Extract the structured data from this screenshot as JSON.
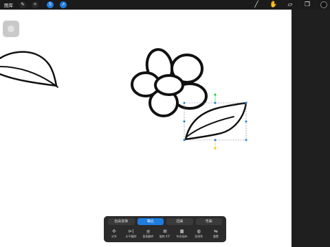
{
  "topbar": {
    "gallery_label": "图库",
    "left_tools": [
      {
        "name": "wrench-icon",
        "glyph": "✎",
        "active": false
      },
      {
        "name": "magic-wand-icon",
        "glyph": "✧",
        "active": false
      },
      {
        "name": "selection-icon",
        "glyph": "S",
        "active": true
      },
      {
        "name": "transform-arrow-icon",
        "glyph": "➚",
        "active": true
      }
    ],
    "right_tools": [
      {
        "name": "brush-icon",
        "glyph": "╱"
      },
      {
        "name": "smudge-icon",
        "glyph": "✋"
      },
      {
        "name": "eraser-icon",
        "glyph": "▱"
      },
      {
        "name": "layers-icon",
        "glyph": "❐"
      }
    ],
    "color_swatch": "#111111"
  },
  "transform": {
    "modes": [
      {
        "label": "自由变换",
        "active": false
      },
      {
        "label": "等比",
        "active": true
      },
      {
        "label": "扭曲",
        "active": false
      },
      {
        "label": "弯曲",
        "active": false
      }
    ],
    "actions": [
      {
        "icon": "✣",
        "label": "对齐"
      },
      {
        "icon": "⊳|",
        "label": "水平翻转"
      },
      {
        "icon": "⊴",
        "label": "垂直翻转"
      },
      {
        "icon": "⊞",
        "label": "旋转 45°"
      },
      {
        "icon": "▦",
        "label": "符合画布"
      },
      {
        "icon": "◍",
        "label": "双线性"
      },
      {
        "icon": "⇆",
        "label": "重置"
      }
    ]
  },
  "colors": {
    "accent": "#1f7de0",
    "handle_green": "#2ecc40",
    "handle_yellow": "#f5c518",
    "handle_blue": "#1f7de0"
  }
}
